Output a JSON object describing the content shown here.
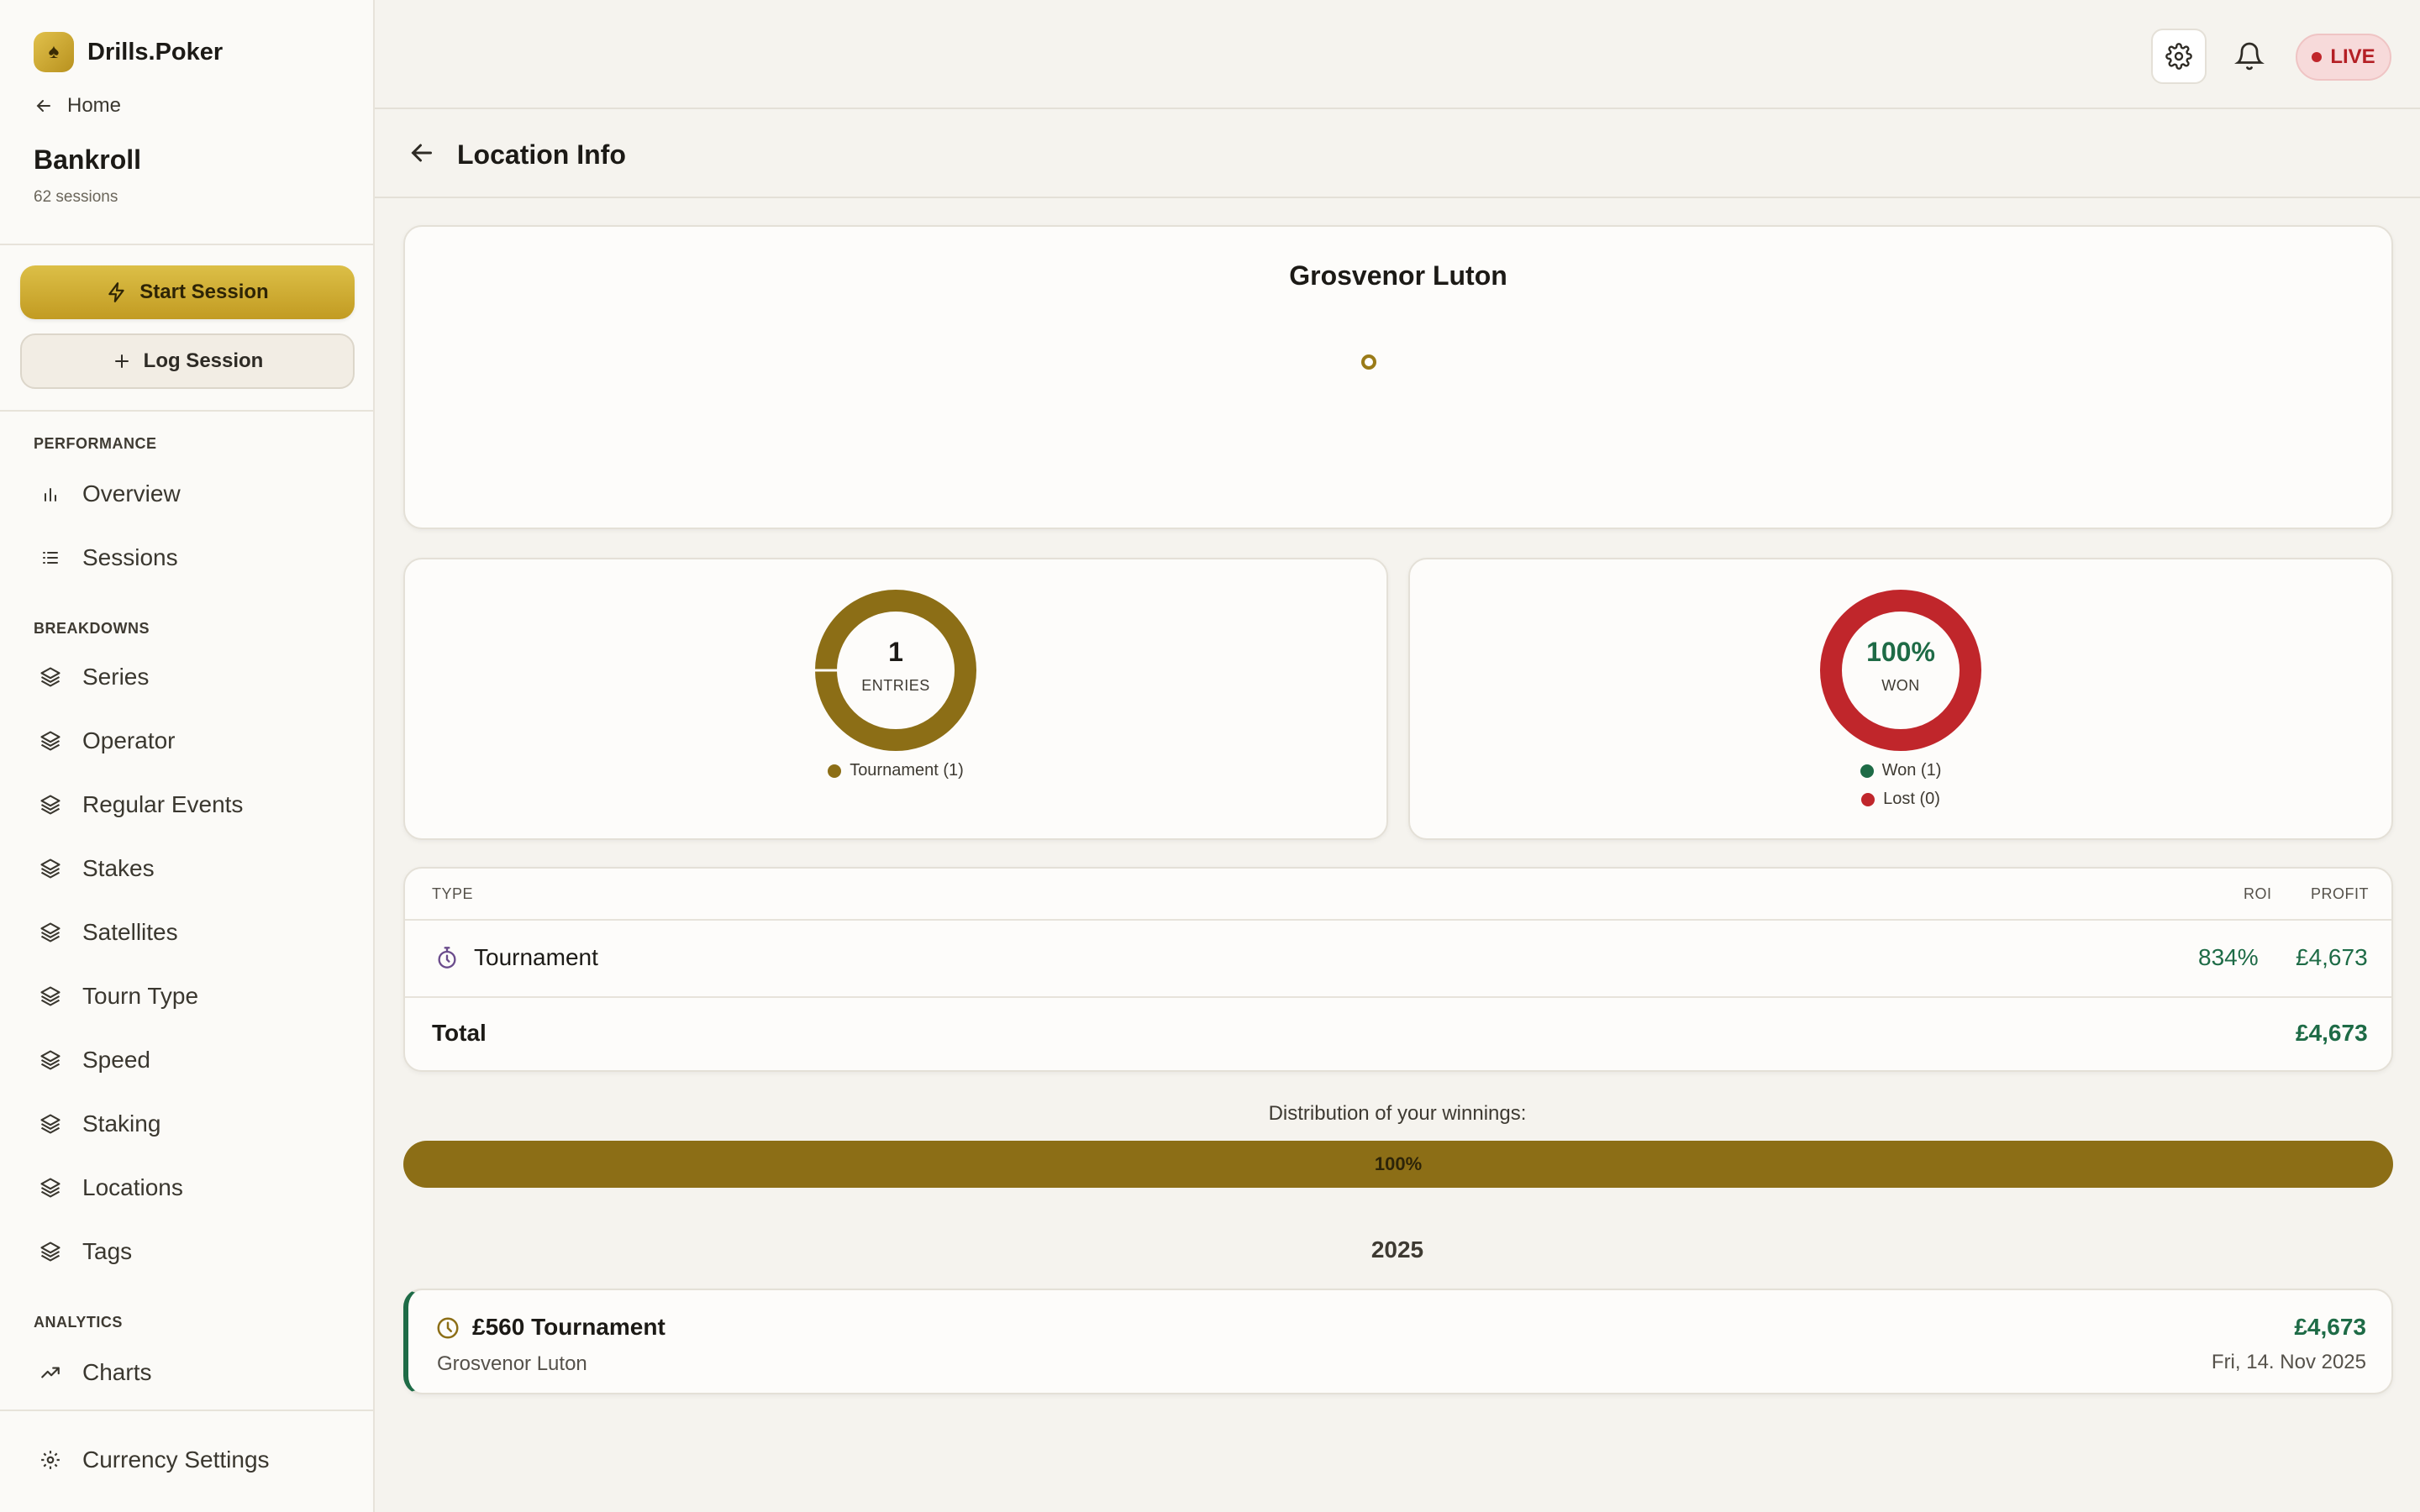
{
  "brand": {
    "name": "Drills.Poker",
    "logo_icon": "spade-icon"
  },
  "sidebar": {
    "home_label": "Home",
    "title": "Bankroll",
    "session_count": "62 sessions",
    "start_session": "Start Session",
    "log_session": "Log Session",
    "sections": {
      "performance": "PERFORMANCE",
      "breakdowns": "BREAKDOWNS",
      "analytics": "ANALYTICS"
    },
    "performance_items": [
      "Overview",
      "Sessions"
    ],
    "breakdown_items": [
      "Series",
      "Operator",
      "Regular Events",
      "Stakes",
      "Satellites",
      "Tourn Type",
      "Speed",
      "Staking",
      "Locations",
      "Tags"
    ],
    "analytics_items": [
      "Charts"
    ],
    "footer_item": "Currency Settings"
  },
  "topbar": {
    "live_label": "LIVE"
  },
  "header": {
    "title": "Location Info"
  },
  "location": {
    "name": "Grosvenor Luton"
  },
  "entries_donut": {
    "value": "1",
    "label": "ENTRIES",
    "legend": [
      {
        "label": "Tournament (1)",
        "color": "#8c6e16"
      }
    ]
  },
  "won_donut": {
    "value": "100%",
    "label": "WON",
    "won_fraction": 1.0,
    "legend": [
      {
        "label": "Won (1)",
        "color": "#1e6b46"
      },
      {
        "label": "Lost (0)",
        "color": "#c0262b"
      }
    ]
  },
  "table": {
    "headers": {
      "type": "TYPE",
      "roi": "ROI",
      "profit": "PROFIT"
    },
    "rows": [
      {
        "type": "Tournament",
        "icon": "stopwatch-icon",
        "roi": "834%",
        "profit": "£4,673"
      }
    ],
    "total_label": "Total",
    "total_profit": "£4,673"
  },
  "distribution": {
    "label": "Distribution of your winnings:",
    "percent_label": "100%",
    "fraction": 1.0
  },
  "year": "2025",
  "entries": [
    {
      "title": "£560 Tournament",
      "location": "Grosvenor Luton",
      "profit": "£4,673",
      "date": "Fri, 14. Nov 2025"
    }
  ],
  "colors": {
    "accent": "#c29b22",
    "gold": "#8c6e16",
    "green": "#1e6b46",
    "red": "#c0262b"
  }
}
